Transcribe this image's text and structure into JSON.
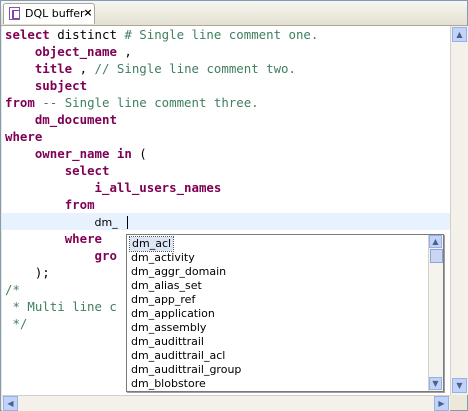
{
  "tab": {
    "label": "DQL buffer",
    "close": "×"
  },
  "editor": {
    "lines": [
      {
        "parts": [
          [
            "kw",
            "select"
          ],
          [
            "pl",
            " distinct "
          ],
          [
            "cm",
            "# Single line comment one."
          ]
        ]
      },
      {
        "parts": [
          [
            "pl",
            "    "
          ],
          [
            "id",
            "object_name"
          ],
          [
            "pl",
            " ,"
          ]
        ]
      },
      {
        "parts": [
          [
            "pl",
            "    "
          ],
          [
            "id",
            "title"
          ],
          [
            "pl",
            " , "
          ],
          [
            "cm",
            "// Single line comment two."
          ]
        ]
      },
      {
        "parts": [
          [
            "pl",
            "    "
          ],
          [
            "id",
            "subject"
          ]
        ]
      },
      {
        "parts": [
          [
            "kw",
            "from"
          ],
          [
            "pl",
            " "
          ],
          [
            "cm",
            "-- Single line comment three."
          ]
        ]
      },
      {
        "parts": [
          [
            "pl",
            "    "
          ],
          [
            "id",
            "dm_document"
          ]
        ]
      },
      {
        "parts": [
          [
            "kw",
            "where"
          ]
        ]
      },
      {
        "parts": [
          [
            "pl",
            "    "
          ],
          [
            "id",
            "owner_name"
          ],
          [
            "pl",
            " "
          ],
          [
            "kw",
            "in"
          ],
          [
            "pl",
            " ("
          ]
        ]
      },
      {
        "parts": [
          [
            "pl",
            "        "
          ],
          [
            "kw",
            "select"
          ]
        ]
      },
      {
        "parts": [
          [
            "pl",
            "            "
          ],
          [
            "id",
            "i_all_users_names"
          ]
        ]
      },
      {
        "parts": [
          [
            "pl",
            "        "
          ],
          [
            "kw",
            "from"
          ]
        ]
      },
      {
        "parts": [
          [
            "pl",
            "            "
          ],
          [
            "sm",
            "dm_"
          ]
        ]
      },
      {
        "parts": [
          [
            "pl",
            "        "
          ],
          [
            "kw",
            "where"
          ]
        ]
      },
      {
        "parts": [
          [
            "pl",
            "            "
          ],
          [
            "kw",
            "gro"
          ]
        ]
      },
      {
        "parts": [
          [
            "pl",
            "    );"
          ]
        ]
      },
      {
        "parts": [
          [
            "cm",
            "/*"
          ]
        ]
      },
      {
        "parts": [
          [
            "cm",
            " * Multi line c"
          ]
        ]
      },
      {
        "parts": [
          [
            "cm",
            " */"
          ]
        ]
      }
    ]
  },
  "autocomplete": {
    "items": [
      "dm_acl",
      "dm_activity",
      "dm_aggr_domain",
      "dm_alias_set",
      "dm_app_ref",
      "dm_application",
      "dm_assembly",
      "dm_audittrail",
      "dm_audittrail_acl",
      "dm_audittrail_group",
      "dm_blobstore"
    ],
    "selected_index": 0
  },
  "scroll_arrows": {
    "up": "▲",
    "down": "▼",
    "left": "◀",
    "right": "▶"
  }
}
